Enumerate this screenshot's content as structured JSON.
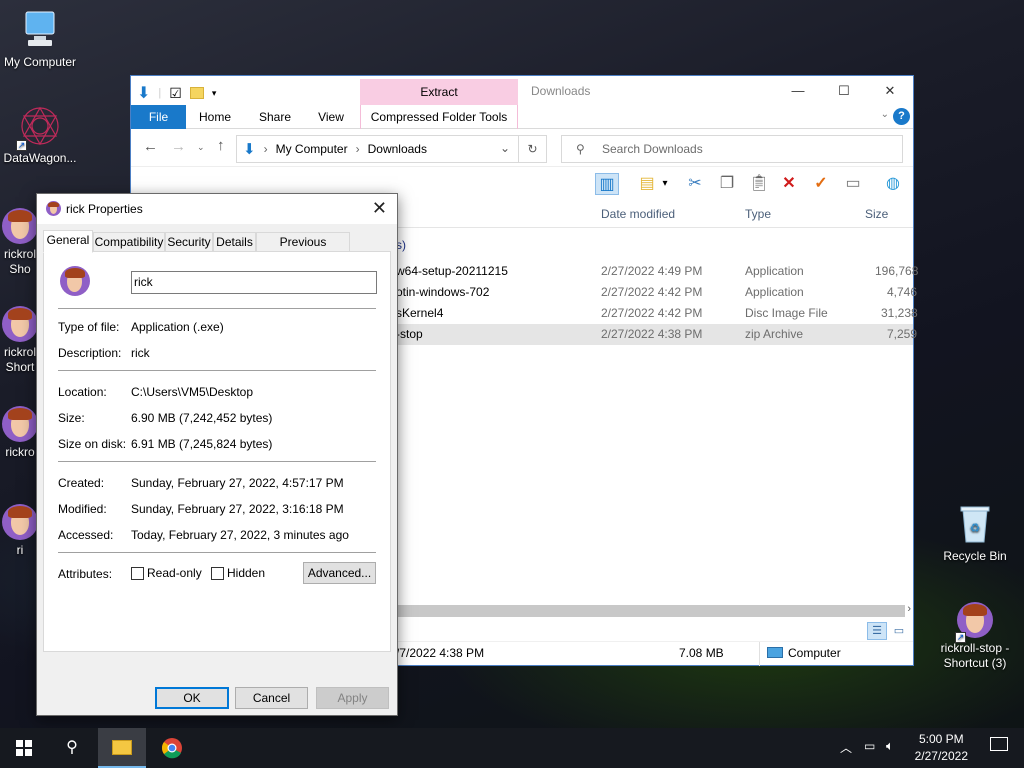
{
  "desktop": {
    "icons": [
      {
        "label": "My Computer"
      },
      {
        "label": "DataWagon..."
      },
      {
        "label": "rickrol",
        "label2": "Sho"
      },
      {
        "label": "rickrol",
        "label2": "Short"
      },
      {
        "label": "rickro"
      },
      {
        "label": "ri"
      },
      {
        "label": "Recycle Bin"
      },
      {
        "label": "rickroll-stop -",
        "label2": "Shortcut (3)"
      }
    ]
  },
  "explorer": {
    "ribbon_context_tab": "Extract",
    "window_title": "Downloads",
    "tabs": [
      "File",
      "Home",
      "Share",
      "View",
      "Compressed Folder Tools"
    ],
    "breadcrumb": [
      "My Computer",
      "Downloads"
    ],
    "search_placeholder": "Search Downloads",
    "columns": {
      "date": "Date modified",
      "type": "Type",
      "size": "Size"
    },
    "group_label": "s)",
    "rows": [
      {
        "name": "w64-setup-20211215",
        "date": "2/27/2022 4:49 PM",
        "type": "Application",
        "size": "196,768"
      },
      {
        "name": "otin-windows-702",
        "date": "2/27/2022 4:42 PM",
        "type": "Application",
        "size": "4,746"
      },
      {
        "name": "sKernel4",
        "date": "2/27/2022 4:42 PM",
        "type": "Disc Image File",
        "size": "31,238"
      },
      {
        "name": "-stop",
        "date": "2/27/2022 4:38 PM",
        "type": "zip Archive",
        "size": "7,259"
      }
    ],
    "status": {
      "modified": "/7/2022 4:38 PM",
      "size": "7.08 MB",
      "location": "Computer"
    }
  },
  "props": {
    "title": "rick Properties",
    "tabs": [
      "General",
      "Compatibility",
      "Security",
      "Details",
      "Previous Versions"
    ],
    "name": "rick",
    "type_label": "Type of file:",
    "type_value": "Application (.exe)",
    "desc_label": "Description:",
    "desc_value": "rick",
    "location_label": "Location:",
    "location_value": "C:\\Users\\VM5\\Desktop",
    "size_label": "Size:",
    "size_value": "6.90 MB (7,242,452 bytes)",
    "disk_label": "Size on disk:",
    "disk_value": "6.91 MB (7,245,824 bytes)",
    "created_label": "Created:",
    "created_value": "Sunday, February 27, 2022, 4:57:17 PM",
    "modified_label": "Modified:",
    "modified_value": "Sunday, February 27, 2022, 3:16:18 PM",
    "accessed_label": "Accessed:",
    "accessed_value": "Today, February 27, 2022, 3 minutes ago",
    "attributes_label": "Attributes:",
    "readonly_label": "Read-only",
    "hidden_label": "Hidden",
    "advanced_label": "Advanced...",
    "ok_label": "OK",
    "cancel_label": "Cancel",
    "apply_label": "Apply"
  },
  "taskbar": {
    "time": "5:00 PM",
    "date": "2/27/2022"
  }
}
